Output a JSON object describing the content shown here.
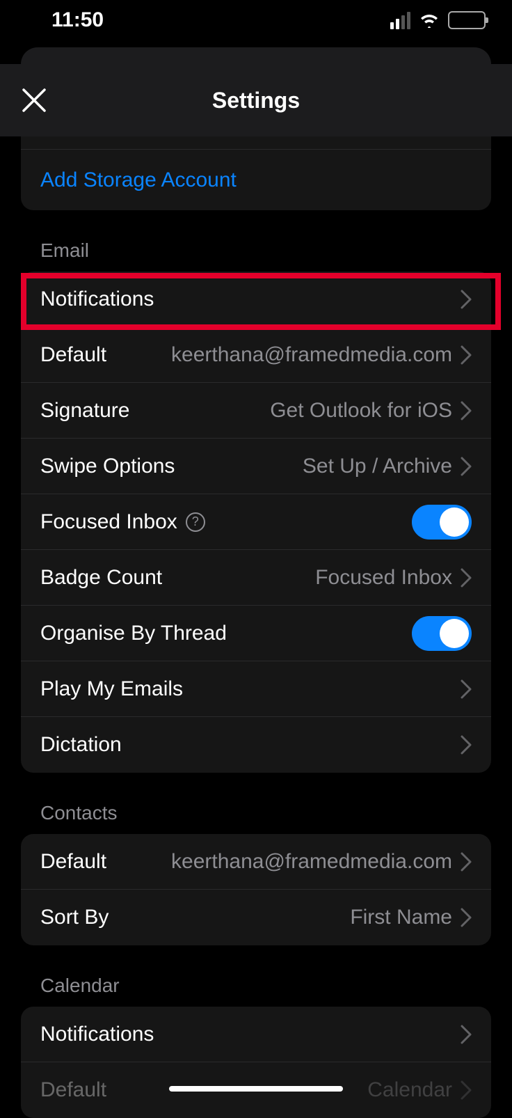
{
  "status": {
    "time": "11:50"
  },
  "header": {
    "title": "Settings"
  },
  "accounts": {
    "add_storage_label": "Add Storage Account"
  },
  "sections": {
    "email_header": "Email",
    "contacts_header": "Contacts",
    "calendar_header": "Calendar"
  },
  "email": {
    "notifications_label": "Notifications",
    "default_label": "Default",
    "default_value": "keerthana@framedmedia.com",
    "signature_label": "Signature",
    "signature_value": "Get Outlook for iOS",
    "swipe_label": "Swipe Options",
    "swipe_value": "Set Up / Archive",
    "focused_label": "Focused Inbox",
    "badge_label": "Badge Count",
    "badge_value": "Focused Inbox",
    "organise_label": "Organise By Thread",
    "play_label": "Play My Emails",
    "dictation_label": "Dictation"
  },
  "contacts": {
    "default_label": "Default",
    "default_value": "keerthana@framedmedia.com",
    "sort_label": "Sort By",
    "sort_value": "First Name"
  },
  "calendar": {
    "notifications_label": "Notifications",
    "default_label": "Default",
    "default_value": "Calendar"
  }
}
